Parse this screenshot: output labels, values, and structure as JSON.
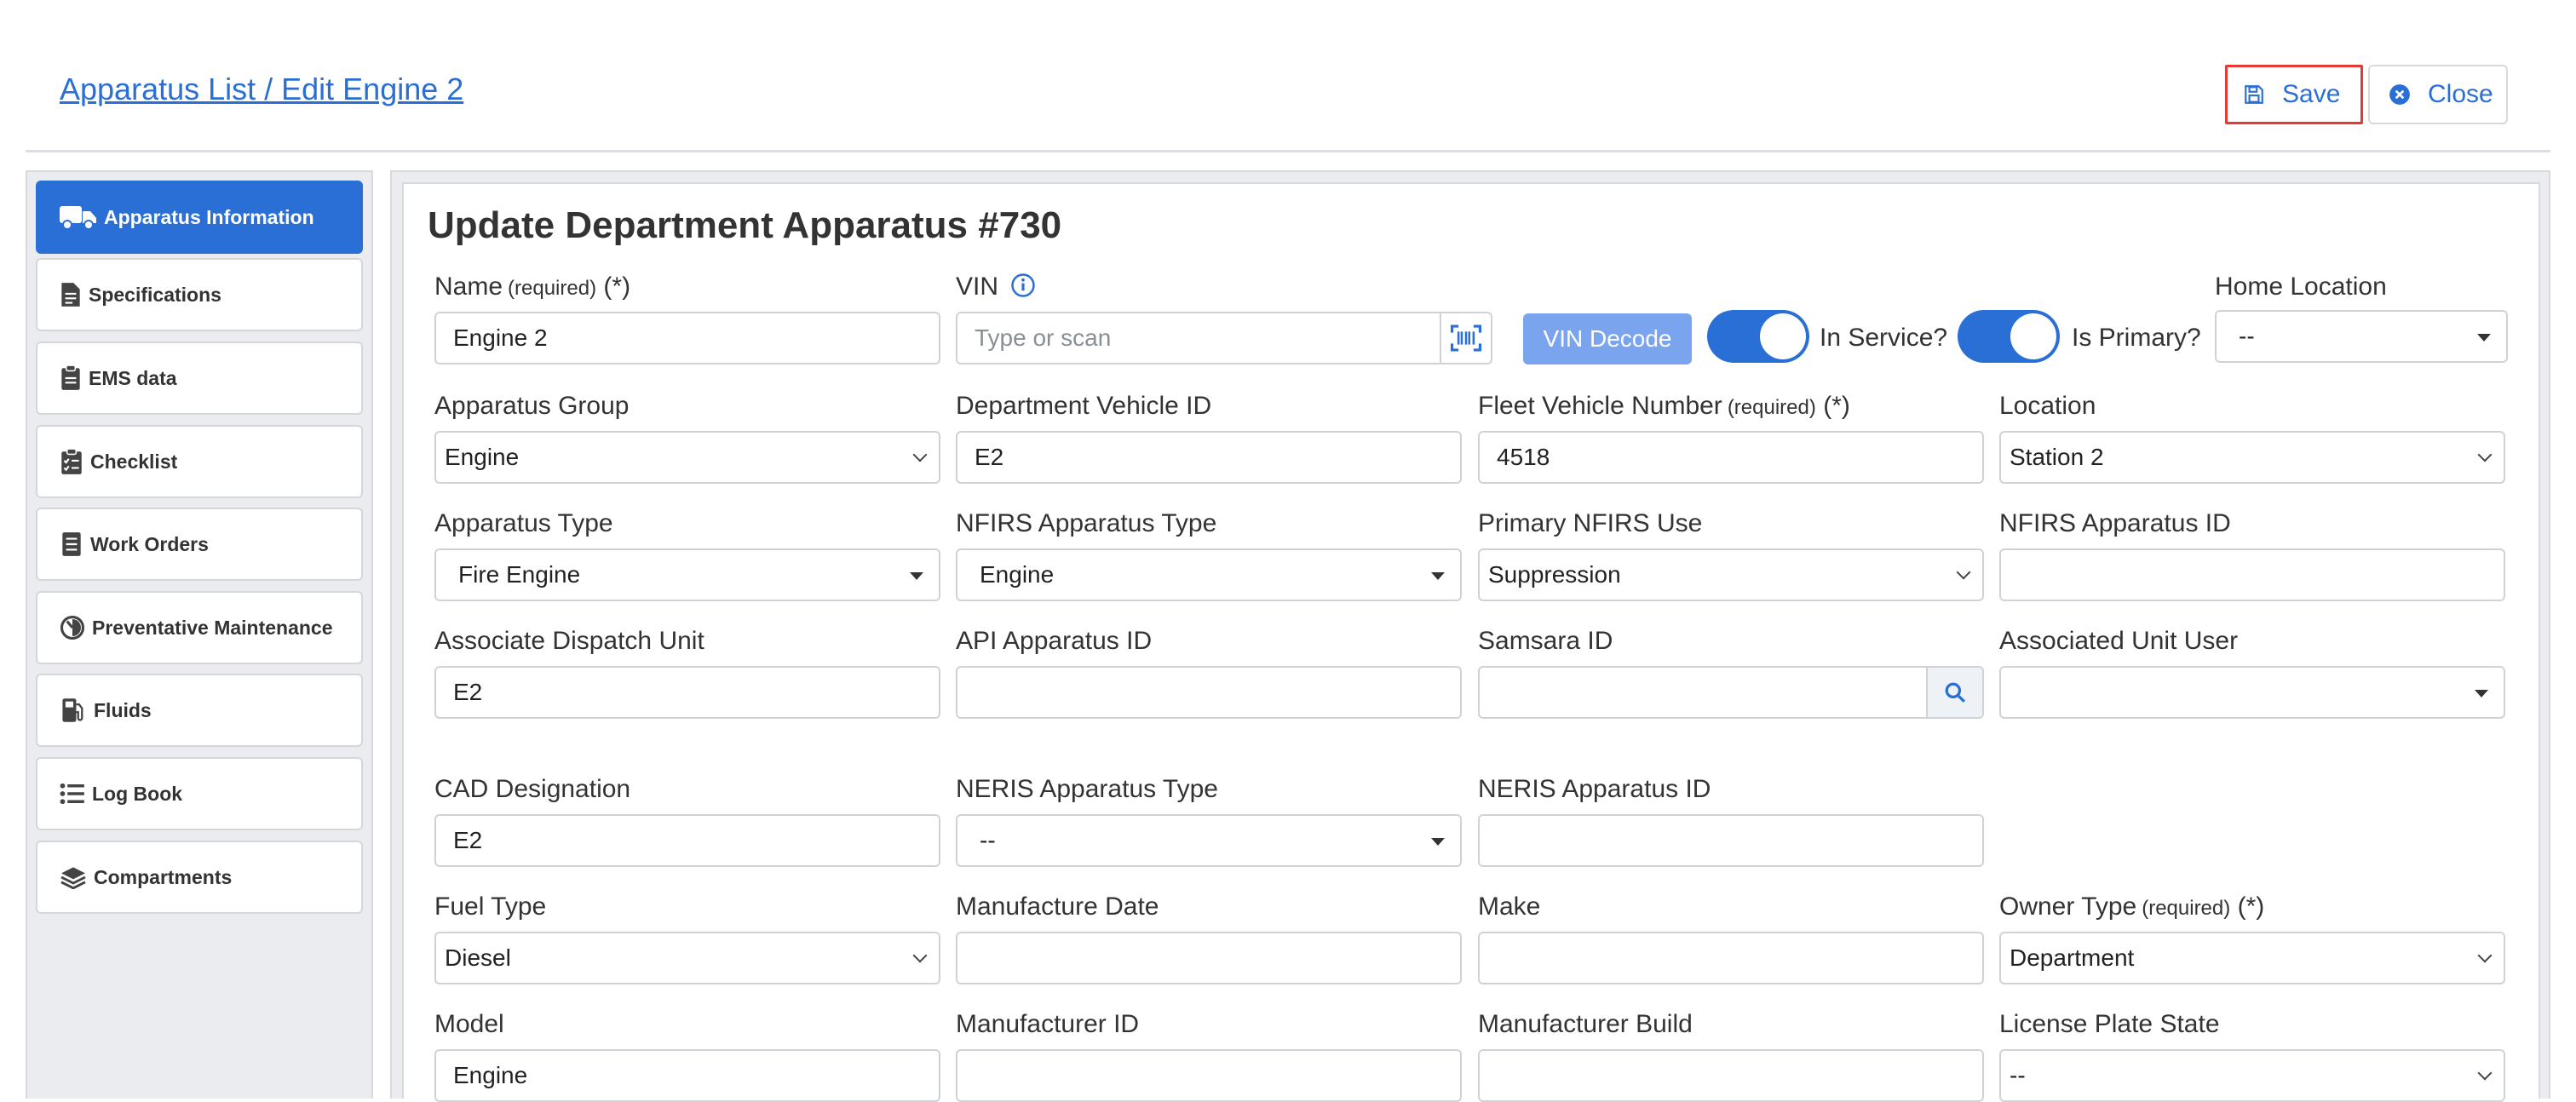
{
  "header": {
    "breadcrumb": "Apparatus List / Edit Engine 2",
    "save_label": "Save",
    "close_label": "Close"
  },
  "sidebar": {
    "items": [
      {
        "label": "Apparatus Information",
        "icon": "truck-icon",
        "active": true
      },
      {
        "label": "Specifications",
        "icon": "document-icon"
      },
      {
        "label": "EMS data",
        "icon": "clipboard-icon"
      },
      {
        "label": "Checklist",
        "icon": "checklist-icon"
      },
      {
        "label": "Work Orders",
        "icon": "list-doc-icon"
      },
      {
        "label": "Preventative Maintenance",
        "icon": "gauge-icon"
      },
      {
        "label": "Fluids",
        "icon": "fuel-pump-icon"
      },
      {
        "label": "Log Book",
        "icon": "list-icon"
      },
      {
        "label": "Compartments",
        "icon": "layers-icon"
      }
    ]
  },
  "main": {
    "title": "Update Department Apparatus #730",
    "required_tag": "(required)",
    "required_mark": "(*)",
    "fields": {
      "name": {
        "label": "Name",
        "value": "Engine 2"
      },
      "vin": {
        "label": "VIN",
        "placeholder": "Type or scan"
      },
      "vin_decode": "VIN Decode",
      "in_service": {
        "label": "In Service?",
        "on": true
      },
      "is_primary": {
        "label": "Is Primary?",
        "on": true
      },
      "home_location": {
        "label": "Home Location",
        "value": "--"
      },
      "apparatus_group": {
        "label": "Apparatus Group",
        "value": "Engine"
      },
      "dept_vehicle_id": {
        "label": "Department Vehicle ID",
        "value": "E2"
      },
      "fleet_vehicle_number": {
        "label": "Fleet Vehicle Number",
        "value": "4518"
      },
      "location": {
        "label": "Location",
        "value": "Station 2"
      },
      "apparatus_type": {
        "label": "Apparatus Type",
        "value": "Fire Engine"
      },
      "nfirs_apparatus_type": {
        "label": "NFIRS Apparatus Type",
        "value": "Engine"
      },
      "primary_nfirs_use": {
        "label": "Primary NFIRS Use",
        "value": "Suppression"
      },
      "nfirs_apparatus_id": {
        "label": "NFIRS Apparatus ID",
        "value": ""
      },
      "associate_dispatch_unit": {
        "label": "Associate Dispatch Unit",
        "value": "E2"
      },
      "api_apparatus_id": {
        "label": "API Apparatus ID",
        "value": ""
      },
      "samsara_id": {
        "label": "Samsara ID",
        "value": ""
      },
      "associated_unit_user": {
        "label": "Associated Unit User",
        "value": ""
      },
      "cad_designation": {
        "label": "CAD Designation",
        "value": "E2"
      },
      "neris_apparatus_type": {
        "label": "NERIS Apparatus Type",
        "value": "--"
      },
      "neris_apparatus_id": {
        "label": "NERIS Apparatus ID",
        "value": ""
      },
      "fuel_type": {
        "label": "Fuel Type",
        "value": "Diesel"
      },
      "manufacture_date": {
        "label": "Manufacture Date",
        "value": ""
      },
      "make": {
        "label": "Make",
        "value": ""
      },
      "owner_type": {
        "label": "Owner Type",
        "value": "Department"
      },
      "model": {
        "label": "Model",
        "value": "Engine"
      },
      "manufacturer_id": {
        "label": "Manufacturer ID",
        "value": ""
      },
      "manufacturer_build": {
        "label": "Manufacturer Build",
        "value": ""
      },
      "license_plate_state": {
        "label": "License Plate State",
        "value": "--"
      }
    }
  },
  "colors": {
    "accent": "#2a6fd6",
    "save_outline": "#e53935",
    "vin_decode_bg": "#7aa4ee",
    "panel_bg": "#eaecef"
  }
}
